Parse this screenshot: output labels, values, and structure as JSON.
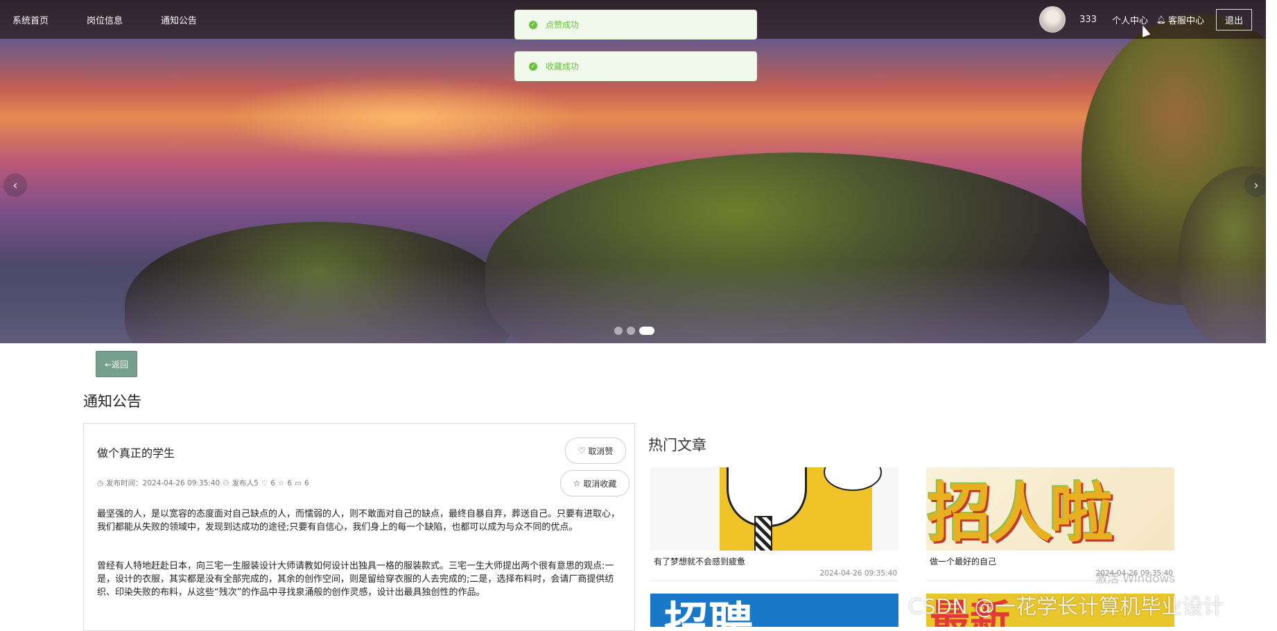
{
  "nav": {
    "items": [
      "系统首页",
      "岗位信息",
      "通知公告"
    ],
    "user_name": "333",
    "profile_label": "个人中心",
    "service_label": "客服中心",
    "logout_label": "退出"
  },
  "toasts": [
    "点赞成功",
    "收藏成功"
  ],
  "carousel": {
    "slide_count": 3,
    "active_index": 2
  },
  "back_label": "←返回",
  "section_title": "通知公告",
  "article": {
    "title": "做个真正的学生",
    "like_button": "取消赞",
    "favorite_button": "取消收藏",
    "meta_publish": "发布时间：2024-04-26 09:35:40",
    "meta_publisher": "发布人5",
    "meta_likes": "6",
    "meta_favorites": "6",
    "meta_comments": "6",
    "paragraphs": [
      "最坚强的人，是以宽容的态度面对自己缺点的人，而懦弱的人，则不敢面对自己的缺点，最终自暴自弃，葬送自己。只要有进取心，我们都能从失败的领域中，发现到达成功的途径;只要有自信心，我们身上的每一个缺陷，也都可以成为与众不同的优点。",
      "曾经有人特地赶赴日本，向三宅一生服装设计大师请教如何设计出独具一格的服装款式。三宅一生大师提出两个很有意思的观点:一是，设计的衣服，其实都是没有全部完成的，其余的创作空间，则是留给穿衣服的人去完成的;二是，选择布料时，会请厂商提供纺织、印染失败的布料，从这些“残次”的作品中寻找泉涌般的创作灵感，设计出最具独创性的作品。"
    ]
  },
  "hot": {
    "title": "热门文章",
    "cards": [
      {
        "title": "有了梦想就不会感到疲惫",
        "date": "2024-04-26 09:35:40",
        "thumb_text": ""
      },
      {
        "title": "做一个最好的自己",
        "date": "2024-04-26 09:35:40",
        "thumb_text": "招人啦"
      },
      {
        "title": "",
        "date": "",
        "thumb_text": "招聘"
      },
      {
        "title": "",
        "date": "",
        "thumb_text": "最新"
      }
    ]
  },
  "overlay": {
    "windows_watermark": "激活 Windows",
    "csdn_watermark": "CSDN @一花学长计算机毕业设计"
  },
  "colors": {
    "accent_green": "#76a08d",
    "toast_green": "#67c23a"
  }
}
